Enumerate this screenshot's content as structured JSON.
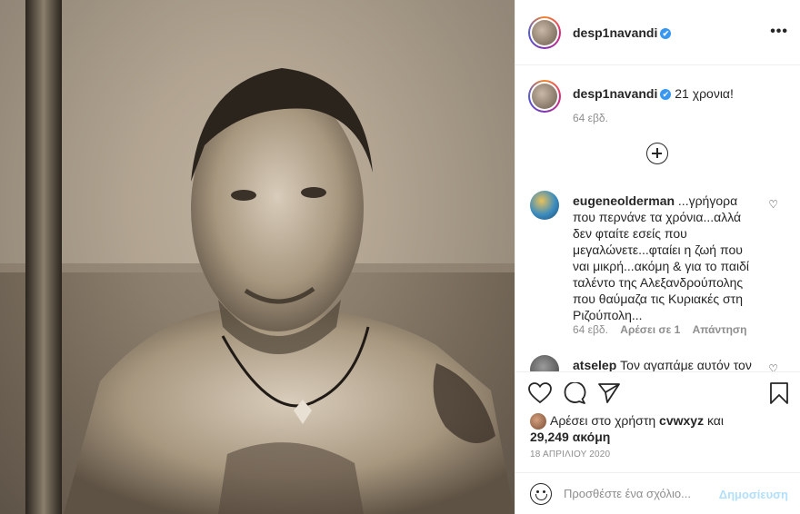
{
  "post": {
    "author": "desp1navandi",
    "caption": "21 χρονια!",
    "caption_time": "64 εβδ.",
    "more_label": "•••",
    "verified_icon": "✔"
  },
  "comments": [
    {
      "user": "eugeneolderman",
      "text": "...γρήγορα που περνάνε τα χρόνια...αλλά δεν φταίτε εσείς που μεγαλώνετε...φταίει η ζωή που ναι μικρή...ακόμη & για το παιδί ταλέντο της Αλεξανδρούπολης που θαύμαζα τις Κυριακές στη Ριζούπολη...",
      "time": "64 εβδ.",
      "likes": "Αρέσει σε 1",
      "reply": "Απάντηση"
    },
    {
      "user": "atselep",
      "text": "Τον αγαπάμε αυτόν τον"
    }
  ],
  "likes": {
    "prefix": "Αρέσει στο χρήστη",
    "user": "cvwxyz",
    "joiner": "και",
    "count": "29,249 ακόμη"
  },
  "date": "18 ΑΠΡΙΛΙΟΥ 2020",
  "add_comment": {
    "placeholder": "Προσθέστε ένα σχόλιο...",
    "post_label": "Δημοσίευση"
  },
  "icons": {
    "heart_small": "♡"
  },
  "colors": {
    "verified": "#3897f0",
    "post_button_disabled": "#b2dffc",
    "muted_text": "#8e8e8e"
  }
}
